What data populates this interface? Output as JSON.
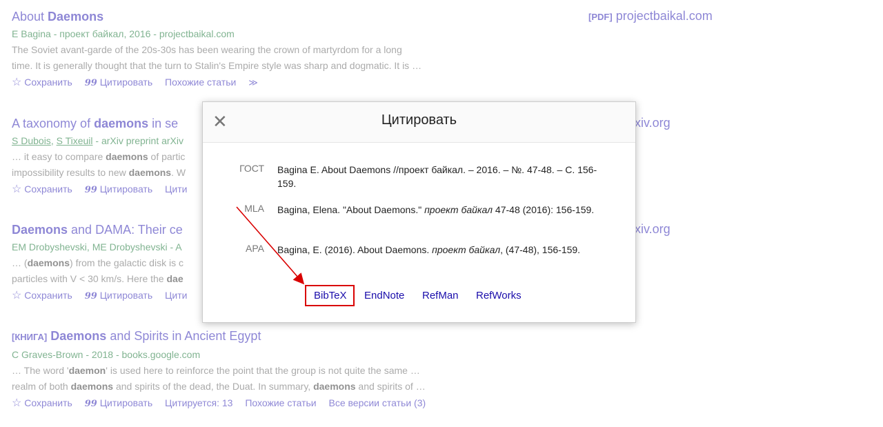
{
  "results": [
    {
      "title_plain": "About ",
      "title_bold": "Daemons",
      "title_rest": "",
      "authors": "E Bagina - проект байкал, 2016 - projectbaikal.com",
      "snippet1": "The Soviet avant-garde of the 20s-30s has been wearing the crown of martyrdom for a long",
      "snippet2": "time. It is generally thought that the turn to Stalin's Empire style was sharp and dogmatic. It is …",
      "actions": {
        "save": "Сохранить",
        "cite": "Цитировать",
        "related": "Похожие статьи"
      }
    },
    {
      "title_plain": "A taxonomy of ",
      "title_bold": "daemons",
      "title_rest": " in se",
      "authors_link1": "S Dubois",
      "authors_link2": "S Tixeuil",
      "authors_rest": " - arXiv preprint arXiv",
      "snippet1_pre": "… it easy to compare ",
      "snippet1_bold": "daemons",
      "snippet1_post": " of partic",
      "snippet2_pre": "impossibility results to new ",
      "snippet2_bold": "daemons",
      "snippet2_post": ". W",
      "actions": {
        "save": "Сохранить",
        "cite": "Цитировать",
        "cited": "Цити"
      }
    },
    {
      "title_bold": "Daemons",
      "title_rest": " and DAMA: Their ce",
      "authors": "EM Drobyshevski, ME Drobyshevski - A",
      "snippet1_pre": "… (",
      "snippet1_bold": "daemons",
      "snippet1_post": ") from the galactic disk is c",
      "snippet2_pre": "particles with V < 30 km/s. Here the ",
      "snippet2_bold": "dae",
      "actions": {
        "save": "Сохранить",
        "cite": "Цитировать",
        "cited": "Цити"
      }
    },
    {
      "prefix": "[КНИГА]",
      "title_bold": "Daemons",
      "title_rest": " and Spirits in Ancient Egypt",
      "authors": "C Graves-Brown - 2018 - books.google.com",
      "snippet1_pre": "… The word '",
      "snippet1_bold": "daemon",
      "snippet1_post": "' is used here to reinforce the point that the group is not quite the same …",
      "snippet2_pre": "realm of both ",
      "snippet2_bold": "daemons",
      "snippet2_mid": " and spirits of the dead, the Duat. In summary, ",
      "snippet2_bold2": "daemons",
      "snippet2_post": " and spirits of …",
      "actions": {
        "save": "Сохранить",
        "cite": "Цитировать",
        "cited": "Цитируется: 13",
        "related": "Похожие статьи",
        "versions": "Все версии статьи (3)"
      }
    }
  ],
  "side_links": {
    "pdf_tag": "[PDF]",
    "pdf_domain": "projectbaikal.com",
    "arxiv1": "xiv.org",
    "arxiv2": "xiv.org"
  },
  "dialog": {
    "title": "Цитировать",
    "close_icon": "close-icon",
    "citations": [
      {
        "label": "ГОСТ",
        "text": "Bagina E. About Daemons //проект байкал. – 2016. – №. 47-48. – С. 156-159."
      },
      {
        "label": "MLA",
        "text_pre": "Bagina, Elena. \"About Daemons.\" ",
        "text_italic": "проект байкал",
        "text_post": " 47-48 (2016): 156-159."
      },
      {
        "label": "APA",
        "text_pre": "Bagina, E. (2016). About Daemons. ",
        "text_italic": "проект байкал",
        "text_post": ", (47-48), 156-159."
      }
    ],
    "export": {
      "bibtex": "BibTeX",
      "endnote": "EndNote",
      "refman": "RefMan",
      "refworks": "RefWorks"
    }
  },
  "colors": {
    "link": "#1a0dab",
    "green": "#006621",
    "annotation_red": "#d90000"
  }
}
